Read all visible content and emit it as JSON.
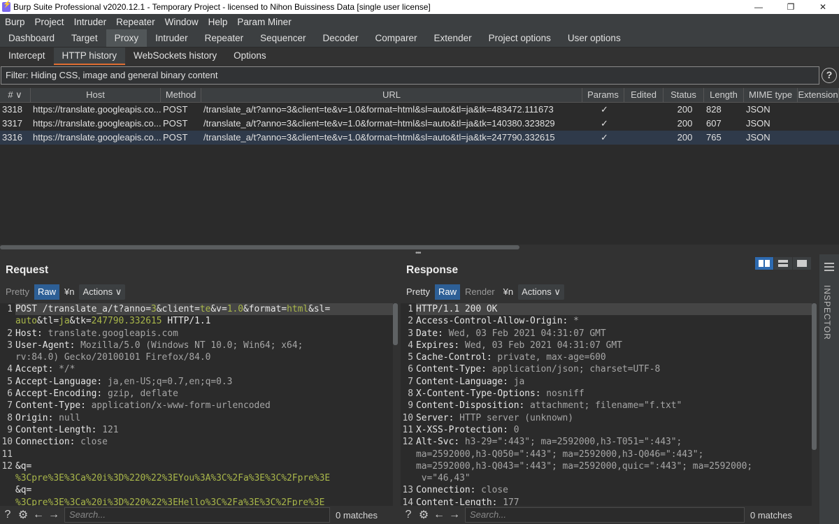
{
  "window": {
    "title": "Burp Suite Professional v2020.12.1 - Temporary Project - licensed to Nihon Buissiness Data [single user license]"
  },
  "menu": [
    "Burp",
    "Project",
    "Intruder",
    "Repeater",
    "Window",
    "Help",
    "Param Miner"
  ],
  "main_tabs": [
    "Dashboard",
    "Target",
    "Proxy",
    "Intruder",
    "Repeater",
    "Sequencer",
    "Decoder",
    "Comparer",
    "Extender",
    "Project options",
    "User options"
  ],
  "main_tab_active": "Proxy",
  "proxy_tabs": [
    "Intercept",
    "HTTP history",
    "WebSockets history",
    "Options"
  ],
  "proxy_tab_active": "HTTP history",
  "filter": {
    "text": "Filter: Hiding CSS, image and general binary content"
  },
  "history": {
    "columns": [
      "# ∨",
      "Host",
      "Method",
      "URL",
      "Params",
      "Edited",
      "Status",
      "Length",
      "MIME type",
      "Extension"
    ],
    "rows": [
      [
        "3318",
        "https://translate.googleapis.co...",
        "POST",
        "/translate_a/t?anno=3&client=te&v=1.0&format=html&sl=auto&tl=ja&tk=483472.111673",
        "✓",
        "",
        "200",
        "828",
        "JSON",
        ""
      ],
      [
        "3317",
        "https://translate.googleapis.co...",
        "POST",
        "/translate_a/t?anno=3&client=te&v=1.0&format=html&sl=auto&tl=ja&tk=140380.323829",
        "✓",
        "",
        "200",
        "607",
        "JSON",
        ""
      ],
      [
        "3316",
        "https://translate.googleapis.co...",
        "POST",
        "/translate_a/t?anno=3&client=te&v=1.0&format=html&sl=auto&tl=ja&tk=247790.332615",
        "✓",
        "",
        "200",
        "765",
        "JSON",
        ""
      ]
    ]
  },
  "request": {
    "title": "Request",
    "tabs": {
      "pretty": "Pretty",
      "raw": "Raw",
      "newline": "¥n",
      "actions": "Actions ∨"
    },
    "lines": [
      {
        "n": "1",
        "parts": [
          [
            "k",
            "POST /translate_a/t?anno="
          ],
          [
            "g",
            "3"
          ],
          [
            "k",
            "&client="
          ],
          [
            "g",
            "te"
          ],
          [
            "k",
            "&v="
          ],
          [
            "g",
            "1.0"
          ],
          [
            "k",
            "&format="
          ],
          [
            "g",
            "html"
          ],
          [
            "k",
            "&sl="
          ]
        ]
      },
      {
        "n": "",
        "parts": [
          [
            "g",
            "auto"
          ],
          [
            "k",
            "&tl="
          ],
          [
            "g",
            "ja"
          ],
          [
            "k",
            "&tk="
          ],
          [
            "g",
            "247790.332615"
          ],
          [
            "k",
            " HTTP/1.1"
          ]
        ]
      },
      {
        "n": "2",
        "parts": [
          [
            "k",
            "Host: "
          ],
          [
            "v",
            "translate.googleapis.com"
          ]
        ]
      },
      {
        "n": "3",
        "parts": [
          [
            "k",
            "User-Agent: "
          ],
          [
            "v",
            "Mozilla/5.0 (Windows NT 10.0; Win64; x64;"
          ]
        ]
      },
      {
        "n": "",
        "parts": [
          [
            "v",
            "rv:84.0) Gecko/20100101 Firefox/84.0"
          ]
        ]
      },
      {
        "n": "4",
        "parts": [
          [
            "k",
            "Accept: "
          ],
          [
            "v",
            "*/*"
          ]
        ]
      },
      {
        "n": "5",
        "parts": [
          [
            "k",
            "Accept-Language: "
          ],
          [
            "v",
            "ja,en-US;q=0.7,en;q=0.3"
          ]
        ]
      },
      {
        "n": "6",
        "parts": [
          [
            "k",
            "Accept-Encoding: "
          ],
          [
            "v",
            "gzip, deflate"
          ]
        ]
      },
      {
        "n": "7",
        "parts": [
          [
            "k",
            "Content-Type: "
          ],
          [
            "v",
            "application/x-www-form-urlencoded"
          ]
        ]
      },
      {
        "n": "8",
        "parts": [
          [
            "k",
            "Origin: "
          ],
          [
            "v",
            "null"
          ]
        ]
      },
      {
        "n": "9",
        "parts": [
          [
            "k",
            "Content-Length: "
          ],
          [
            "v",
            "121"
          ]
        ]
      },
      {
        "n": "10",
        "parts": [
          [
            "k",
            "Connection: "
          ],
          [
            "v",
            "close"
          ]
        ]
      },
      {
        "n": "11",
        "parts": []
      },
      {
        "n": "12",
        "parts": [
          [
            "k",
            "&q="
          ]
        ]
      },
      {
        "n": "",
        "parts": [
          [
            "g",
            "%3Cpre%3E%3Ca%20i%3D%220%22%3EYou%3A%3C%2Fa%3E%3C%2Fpre%3E"
          ]
        ]
      },
      {
        "n": "",
        "parts": [
          [
            "k",
            "&q="
          ]
        ]
      },
      {
        "n": "",
        "parts": [
          [
            "g",
            "%3Cpre%3E%3Ca%20i%3D%220%22%3EHello%3C%2Fa%3E%3C%2Fpre%3E"
          ]
        ]
      }
    ],
    "search": {
      "placeholder": "Search...",
      "matches": "0 matches"
    }
  },
  "response": {
    "title": "Response",
    "tabs": {
      "pretty": "Pretty",
      "raw": "Raw",
      "render": "Render",
      "newline": "¥n",
      "actions": "Actions ∨"
    },
    "lines": [
      {
        "n": "1",
        "parts": [
          [
            "k",
            "HTTP/1.1 200 OK"
          ]
        ]
      },
      {
        "n": "2",
        "parts": [
          [
            "k",
            "Access-Control-Allow-Origin: "
          ],
          [
            "v",
            "*"
          ]
        ]
      },
      {
        "n": "3",
        "parts": [
          [
            "k",
            "Date: "
          ],
          [
            "v",
            "Wed, 03 Feb 2021 04:31:07 GMT"
          ]
        ]
      },
      {
        "n": "4",
        "parts": [
          [
            "k",
            "Expires: "
          ],
          [
            "v",
            "Wed, 03 Feb 2021 04:31:07 GMT"
          ]
        ]
      },
      {
        "n": "5",
        "parts": [
          [
            "k",
            "Cache-Control: "
          ],
          [
            "v",
            "private, max-age=600"
          ]
        ]
      },
      {
        "n": "6",
        "parts": [
          [
            "k",
            "Content-Type: "
          ],
          [
            "v",
            "application/json; charset=UTF-8"
          ]
        ]
      },
      {
        "n": "7",
        "parts": [
          [
            "k",
            "Content-Language: "
          ],
          [
            "v",
            "ja"
          ]
        ]
      },
      {
        "n": "8",
        "parts": [
          [
            "k",
            "X-Content-Type-Options: "
          ],
          [
            "v",
            "nosniff"
          ]
        ]
      },
      {
        "n": "9",
        "parts": [
          [
            "k",
            "Content-Disposition: "
          ],
          [
            "v",
            "attachment; filename=\"f.txt\""
          ]
        ]
      },
      {
        "n": "10",
        "parts": [
          [
            "k",
            "Server: "
          ],
          [
            "v",
            "HTTP server (unknown)"
          ]
        ]
      },
      {
        "n": "11",
        "parts": [
          [
            "k",
            "X-XSS-Protection: "
          ],
          [
            "v",
            "0"
          ]
        ]
      },
      {
        "n": "12",
        "parts": [
          [
            "k",
            "Alt-Svc: "
          ],
          [
            "v",
            "h3-29=\":443\"; ma=2592000,h3-T051=\":443\";"
          ]
        ]
      },
      {
        "n": "",
        "parts": [
          [
            "v",
            "ma=2592000,h3-Q050=\":443\"; ma=2592000,h3-Q046=\":443\";"
          ]
        ]
      },
      {
        "n": "",
        "parts": [
          [
            "v",
            "ma=2592000,h3-Q043=\":443\"; ma=2592000,quic=\":443\"; ma=2592000;"
          ]
        ]
      },
      {
        "n": "",
        "parts": [
          [
            "v",
            " v=\"46,43\""
          ]
        ]
      },
      {
        "n": "13",
        "parts": [
          [
            "k",
            "Connection: "
          ],
          [
            "v",
            "close"
          ]
        ]
      },
      {
        "n": "14",
        "parts": [
          [
            "k",
            "Content-Length: "
          ],
          [
            "v",
            "177"
          ]
        ]
      }
    ],
    "search": {
      "placeholder": "Search...",
      "matches": "0 matches"
    }
  },
  "inspector": {
    "label": "INSPECTOR"
  }
}
